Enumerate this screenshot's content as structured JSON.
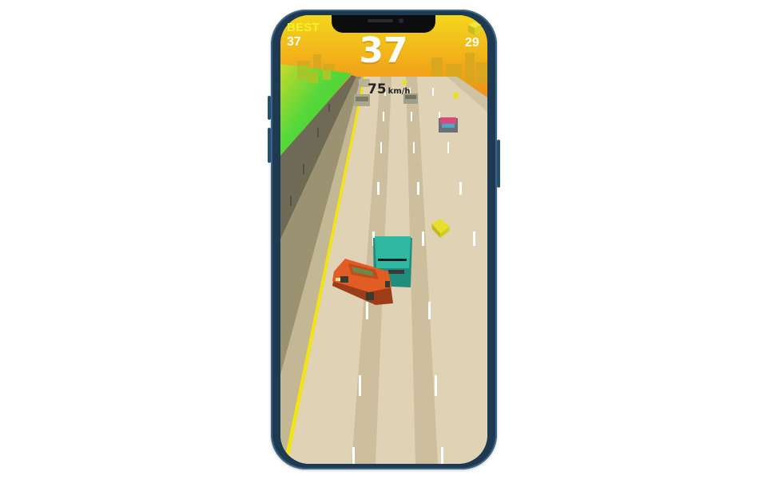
{
  "hud": {
    "best_label": "BEST",
    "best_value": "37",
    "score": "37",
    "speed_value": "75",
    "speed_unit": "km/h",
    "coins": "29",
    "coin_icon": "gold-cube-icon"
  },
  "colors": {
    "phone_frame": "#1d3a52",
    "road": "#e0d2b4",
    "lane_shade": "#cdbf9e",
    "sky_top": "#f3d61b",
    "sky_bottom": "#f08a1a",
    "grass": "#55d83a",
    "player_car": "#e25c25",
    "teal_car": "#2fb8a2",
    "coin": "#e6e02a"
  }
}
